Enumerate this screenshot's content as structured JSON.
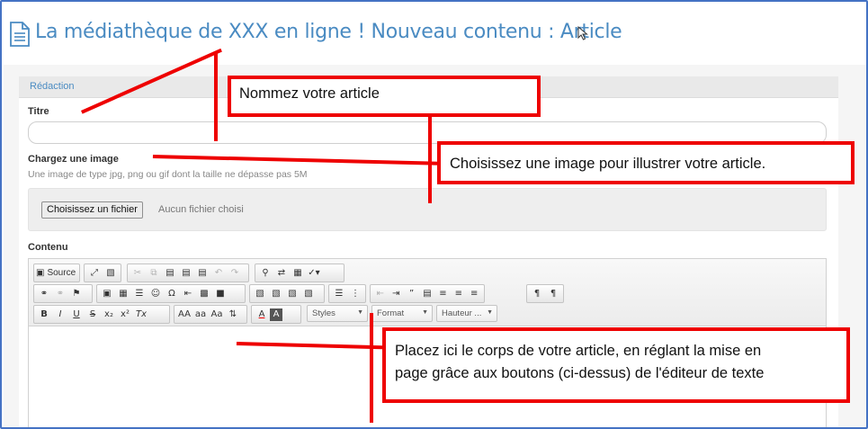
{
  "header": {
    "title": "La médiathèque de XXX en ligne ! Nouveau contenu : Article",
    "icon": "document-icon",
    "title_color": "#4a8bc2"
  },
  "tab": {
    "label": "Rédaction"
  },
  "form": {
    "title_label": "Titre",
    "title_value": "",
    "image_label": "Chargez une image",
    "image_help": "Une image de type jpg, png ou gif dont la taille ne dépasse pas 5M",
    "file_button": "Choisissez un fichier",
    "file_status": "Aucun fichier choisi",
    "content_label": "Contenu"
  },
  "toolbar": {
    "source_label": "Source",
    "styles_combo": "Styles",
    "format_combo": "Format",
    "size_combo": "Hauteur ...",
    "text_labels": {
      "bold": "B",
      "italic": "I",
      "underline": "U",
      "strike": "S",
      "subscript": "x₂",
      "superscript": "x²",
      "remove_format": "Tx",
      "upper": "AA",
      "lower": "aa",
      "capitalize": "Aa",
      "font_color": "A",
      "bg_color": "A"
    }
  },
  "callouts": {
    "name_article": "Nommez votre article",
    "choose_image": "Choisissez une image pour illustrer votre article.",
    "body_line1": "Placez ici le corps de votre article, en réglant la mise en",
    "body_line2": "page grâce aux boutons (ci-dessus) de l'éditeur de texte"
  },
  "colors": {
    "annotation": "#ee0000",
    "frame": "#4472c4",
    "link_blue": "#4a8bc2"
  }
}
